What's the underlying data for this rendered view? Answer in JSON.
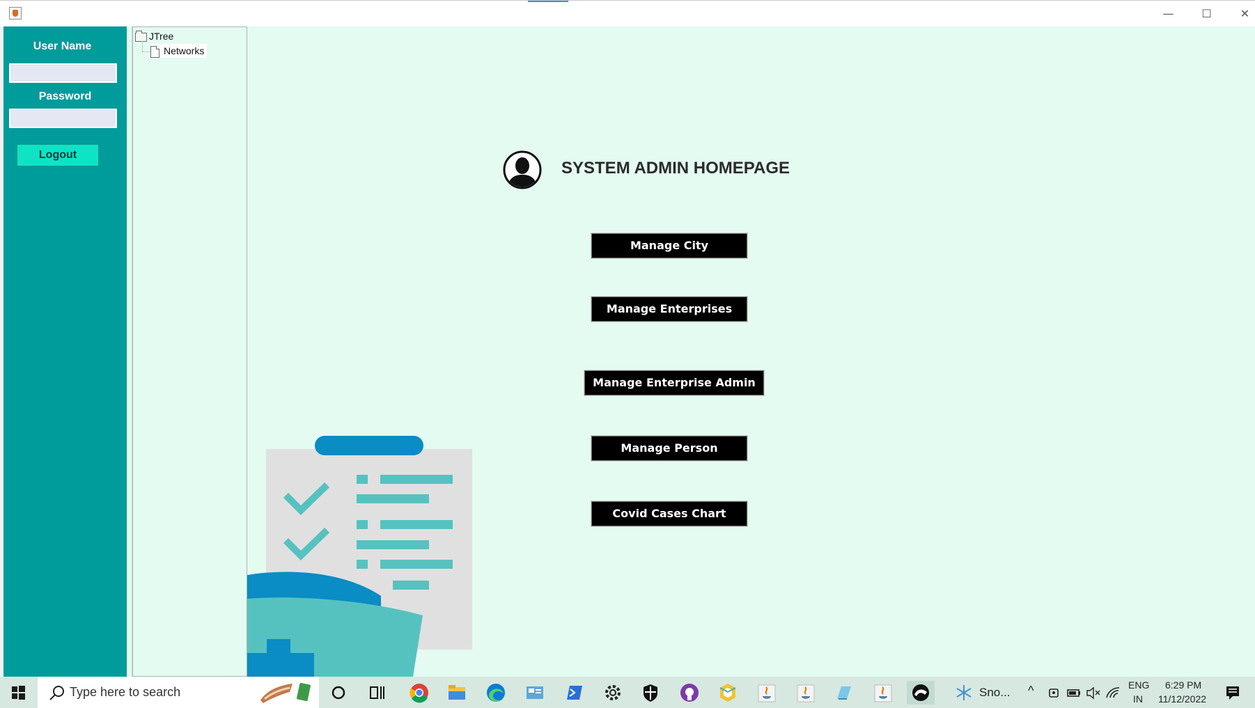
{
  "window": {
    "minimize_glyph": "—",
    "maximize_glyph": "☐",
    "close_glyph": "✕"
  },
  "login": {
    "username_label": "User Name",
    "username_value": "",
    "password_label": "Password",
    "password_value": "",
    "logout_label": "Logout"
  },
  "tree": {
    "root_label": "JTree",
    "child_label": "Networks"
  },
  "main": {
    "title": "SYSTEM ADMIN HOMEPAGE",
    "buttons": [
      {
        "label": "Manage City"
      },
      {
        "label": "Manage Enterprises"
      },
      {
        "label": "Manage Enterprise Admin"
      },
      {
        "label": "Manage Person"
      },
      {
        "label": "Covid Cases Chart"
      }
    ]
  },
  "taskbar": {
    "search_placeholder": "Type here to search",
    "weather_text": "Sno...",
    "language_line1": "ENG",
    "language_line2": "IN",
    "time": "6:29 PM",
    "date": "11/12/2022",
    "icons": [
      "windows-start-icon",
      "search-icon",
      "cortana-icon",
      "task-view-icon",
      "chrome-icon",
      "file-explorer-icon",
      "edge-icon",
      "control-panel-icon",
      "powershell-icon",
      "settings-icon",
      "defender-icon",
      "github-icon",
      "cube-icon",
      "java-icon",
      "java-icon",
      "notepad-icon",
      "java-icon",
      "netbeans-icon",
      "snowflake-icon",
      "chevron-up-icon",
      "meet-now-icon",
      "battery-icon",
      "speaker-muted-icon",
      "wifi-icon",
      "notification-icon"
    ]
  },
  "colors": {
    "sidebar": "#009b9b",
    "panel_background": "#e4fbf1",
    "logout_button": "#0fe3c6",
    "menu_button": "#000000",
    "illustration_teal": "#56c2c0",
    "illustration_blue": "#0a8cc4"
  }
}
